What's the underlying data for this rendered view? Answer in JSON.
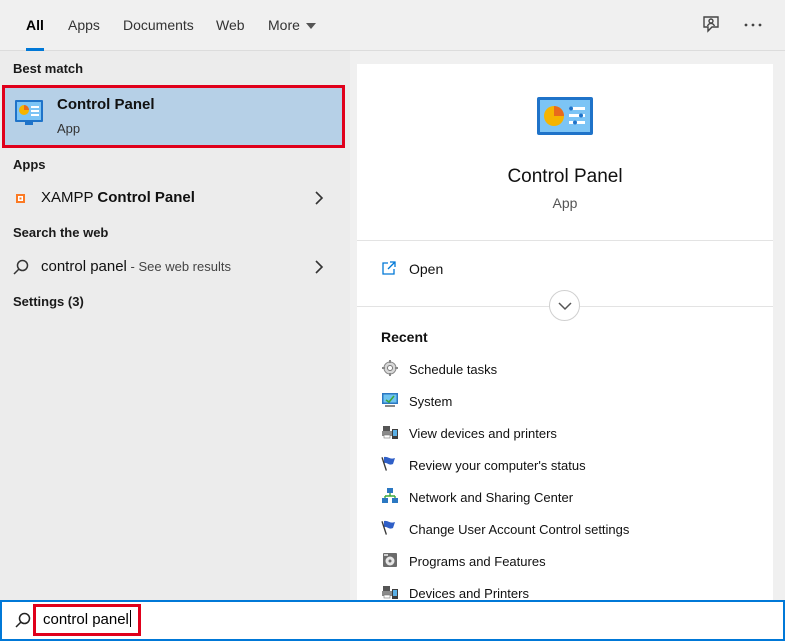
{
  "tabs": [
    {
      "label": "All",
      "active": true
    },
    {
      "label": "Apps"
    },
    {
      "label": "Documents"
    },
    {
      "label": "Web"
    },
    {
      "label": "More"
    }
  ],
  "left": {
    "best_match_heading": "Best match",
    "best_match": {
      "title": "Control Panel",
      "subtitle": "App"
    },
    "apps_heading": "Apps",
    "apps_item": {
      "name_prefix": "XAMPP",
      "name_bold": "Control Panel"
    },
    "web_heading": "Search the web",
    "web_item": {
      "query": "control panel",
      "hint": " - See web results"
    },
    "settings_heading": "Settings (3)"
  },
  "preview": {
    "title": "Control Panel",
    "subtitle": "App",
    "open_label": "Open",
    "recent_heading": "Recent",
    "recent": [
      {
        "label": "Schedule tasks",
        "icon": "schedule-tasks-icon"
      },
      {
        "label": "System",
        "icon": "system-monitor-icon"
      },
      {
        "label": "View devices and printers",
        "icon": "devices-printers-icon"
      },
      {
        "label": "Review your computer's status",
        "icon": "flag-icon"
      },
      {
        "label": "Network and Sharing Center",
        "icon": "network-icon"
      },
      {
        "label": "Change User Account Control settings",
        "icon": "flag-icon"
      },
      {
        "label": "Programs and Features",
        "icon": "programs-icon"
      },
      {
        "label": "Devices and Printers",
        "icon": "devices-printers-icon"
      }
    ]
  },
  "search": {
    "value": "control panel"
  },
  "colors": {
    "accent": "#0078d7",
    "highlight_border": "#e0001b",
    "selected_bg": "#b6d0e7"
  }
}
